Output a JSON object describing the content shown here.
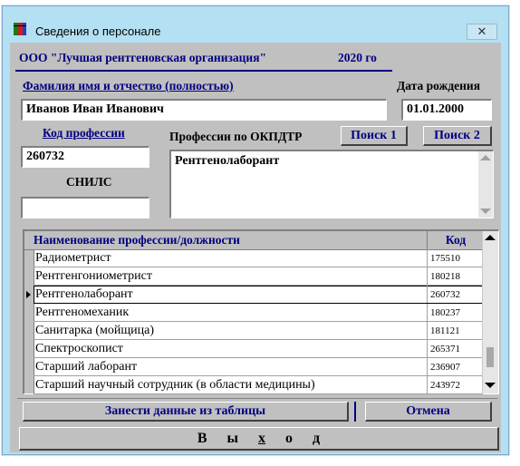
{
  "window": {
    "title": "Сведения о персонале",
    "close_glyph": "✕"
  },
  "header": {
    "org": "ООО \"Лучшая рентгеновская организация\"",
    "year": "2020 го"
  },
  "person": {
    "fio_label": "Фамилия имя и отчество  (полностью)",
    "fio_value": "Иванов Иван Иванович",
    "dob_label": "Дата рождения",
    "dob_value": "01.01.2000"
  },
  "profession": {
    "code_label": "Код профессии",
    "code_value": "260732",
    "snils_label": "СНИЛС",
    "snils_value": "",
    "okpdtr_label": "Профессии по ОКПДТР",
    "search1_label": "Поиск 1",
    "search2_label": "Поиск 2",
    "memo_value": "Рентгенолаборант"
  },
  "table": {
    "col_name": "Наименование профессии/должности",
    "col_code": "Код",
    "selected_index": 2,
    "rows": [
      {
        "name": "Радиометрист",
        "code": "175510"
      },
      {
        "name": "Рентгенгониометрист",
        "code": "180218"
      },
      {
        "name": "Рентгенолаборант",
        "code": "260732"
      },
      {
        "name": "Рентгеномеханик",
        "code": "180237"
      },
      {
        "name": "Санитарка (мойщица)",
        "code": "181121"
      },
      {
        "name": "Спектроскопист",
        "code": "265371"
      },
      {
        "name": "Старший лаборант",
        "code": "236907"
      },
      {
        "name": "Старший научный сотрудник (в области медицины)",
        "code": "243972"
      }
    ]
  },
  "actions": {
    "import_label": "Занести данные из таблицы",
    "cancel_label": "Отмена",
    "exit_parts": [
      "В",
      "ы",
      "х",
      "о",
      "д"
    ]
  },
  "colors": {
    "accent": "#000080",
    "form_bg": "#c0c0c0",
    "frame": "#b3e0f2"
  }
}
